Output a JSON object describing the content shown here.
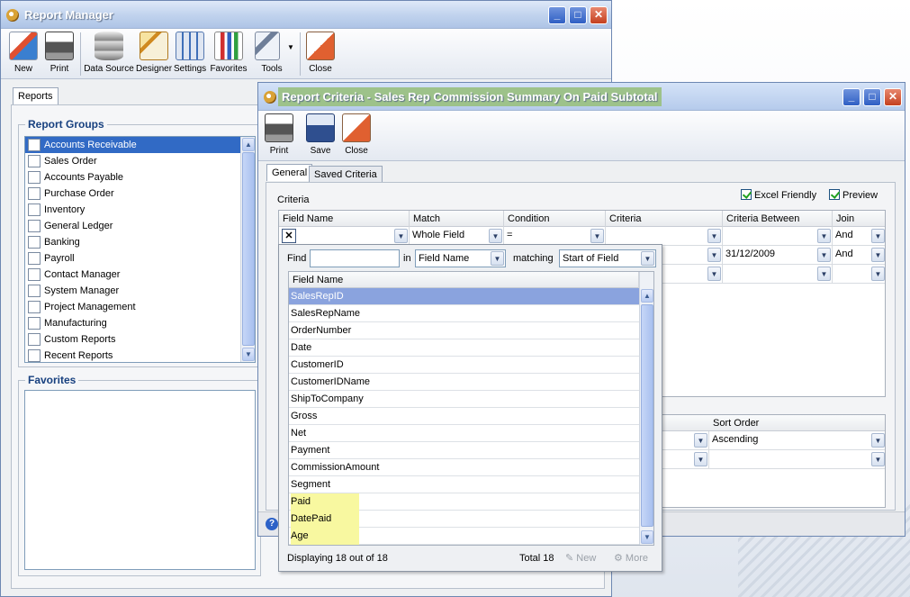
{
  "report_manager": {
    "title": "Report Manager",
    "toolbar": [
      "New",
      "Print",
      "Data Source",
      "Designer",
      "Settings",
      "Favorites",
      "Tools",
      "Close"
    ],
    "tab": "Reports",
    "groups_title": "Report Groups",
    "groups": [
      "Accounts Receivable",
      "Sales Order",
      "Accounts Payable",
      "Purchase Order",
      "Inventory",
      "General Ledger",
      "Banking",
      "Payroll",
      "Contact Manager",
      "System Manager",
      "Project Management",
      "Manufacturing",
      "Custom Reports",
      "Recent Reports"
    ],
    "favorites_title": "Favorites"
  },
  "criteria_window": {
    "title": "Report Criteria - Sales Rep Commission Summary On Paid Subtotal",
    "toolbar": [
      "Print",
      "Save",
      "Close"
    ],
    "tabs": [
      "General",
      "Saved Criteria"
    ],
    "criteria_label": "Criteria",
    "excel_friendly": "Excel Friendly",
    "preview": "Preview",
    "columns": [
      "Field Name",
      "Match",
      "Condition",
      "Criteria",
      "Criteria Between",
      "Join"
    ],
    "row1": {
      "match": "Whole Field",
      "condition": "=",
      "join": "And"
    },
    "row2": {
      "between": "31/12/2009",
      "join": "And"
    },
    "sort_header": "Sort Order",
    "sort_value": "Ascending"
  },
  "field_popup": {
    "find_label": "Find",
    "in_label": "in",
    "in_value": "Field Name",
    "matching_label": "matching",
    "matching_value": "Start of Field",
    "column": "Field Name",
    "fields": [
      "SalesRepID",
      "SalesRepName",
      "OrderNumber",
      "Date",
      "CustomerID",
      "CustomerIDName",
      "ShipToCompany",
      "Gross",
      "Net",
      "Payment",
      "CommissionAmount",
      "Segment",
      "Paid",
      "DatePaid",
      "Age"
    ],
    "displaying": "Displaying 18 out of 18",
    "total": "Total 18",
    "new_label": "New",
    "more_label": "More"
  }
}
